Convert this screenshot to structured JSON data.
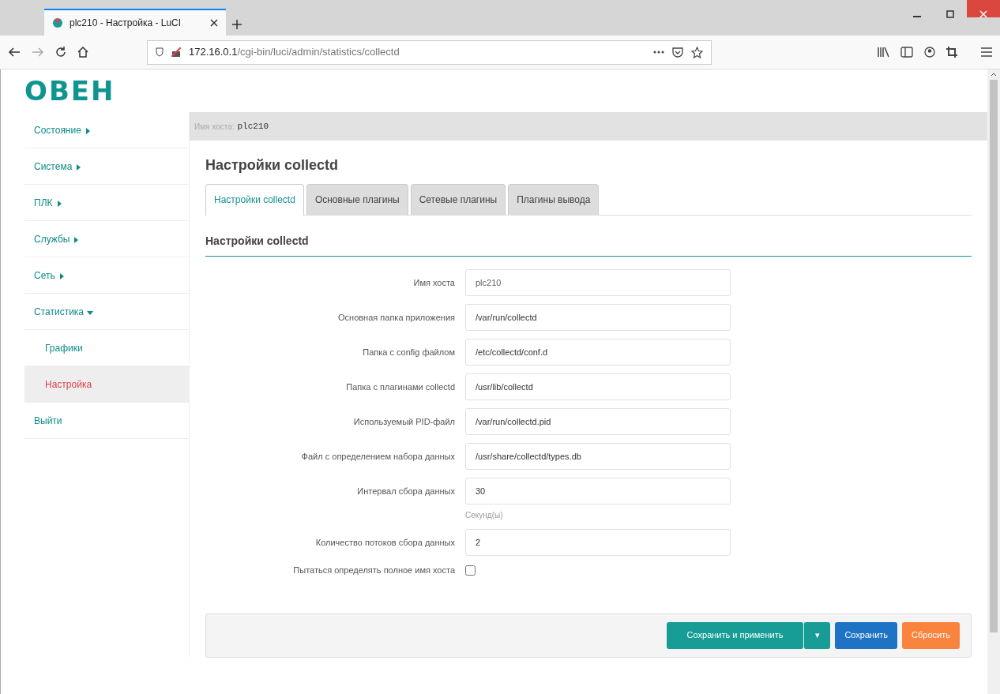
{
  "browser": {
    "tab_title": "plc210 - Настройка - LuCI",
    "url": "**172.16.0.1**/cgi-bin/luci/admin/statistics/collectd"
  },
  "logo": "ОВЕН",
  "sidebar": {
    "items": [
      {
        "label": "Состояние",
        "expanded": false,
        "selected": false
      },
      {
        "label": "Система",
        "expanded": false,
        "selected": false
      },
      {
        "label": "ПЛК",
        "expanded": false,
        "selected": false
      },
      {
        "label": "Службы",
        "expanded": false,
        "selected": false
      },
      {
        "label": "Сеть",
        "expanded": false,
        "selected": false
      },
      {
        "label": "Статистика",
        "expanded": true,
        "selected": false,
        "children": [
          {
            "label": "Графики",
            "selected": false
          },
          {
            "label": "Настройка",
            "selected": true
          }
        ]
      },
      {
        "label": "Выйти",
        "selected": false
      }
    ]
  },
  "hostbar": {
    "label": "Имя хоста:",
    "value": "plc210"
  },
  "page_title": "Настройки collectd",
  "tabs": [
    {
      "label": "Настройки collectd",
      "selected": true
    },
    {
      "label": "Основные плагины",
      "selected": false
    },
    {
      "label": "Сетевые плагины",
      "selected": false
    },
    {
      "label": "Плагины вывода",
      "selected": false
    }
  ],
  "section_title": "Настройки collectd",
  "fields": [
    {
      "kind": "text",
      "label": "Имя хоста",
      "placeholder": "plc210"
    },
    {
      "kind": "text",
      "label": "Основная папка приложения",
      "value": "/var/run/collectd"
    },
    {
      "kind": "text",
      "label": "Папка с config файлом",
      "value": "/etc/collectd/conf.d"
    },
    {
      "kind": "text",
      "label": "Папка с плагинами collectd",
      "value": "/usr/lib/collectd"
    },
    {
      "kind": "text",
      "label": "Используемый PID-файл",
      "value": "/var/run/collectd.pid"
    },
    {
      "kind": "text",
      "label": "Файл с определением набора данных",
      "value": "/usr/share/collectd/types.db"
    },
    {
      "kind": "text",
      "label": "Интервал сбора данных",
      "value": "30",
      "hint": "Секунд(ы)"
    },
    {
      "kind": "text",
      "label": "Количество потоков сбора данных",
      "value": "2"
    },
    {
      "kind": "checkbox",
      "label": "Пытаться определять полное имя хоста",
      "checked": false
    }
  ],
  "buttons": [
    {
      "kind": "apply",
      "label": "Сохранить и применить",
      "dropdown": "▾"
    },
    {
      "kind": "save",
      "label": "Сохранить"
    },
    {
      "kind": "reset",
      "label": "Сбросить"
    }
  ]
}
